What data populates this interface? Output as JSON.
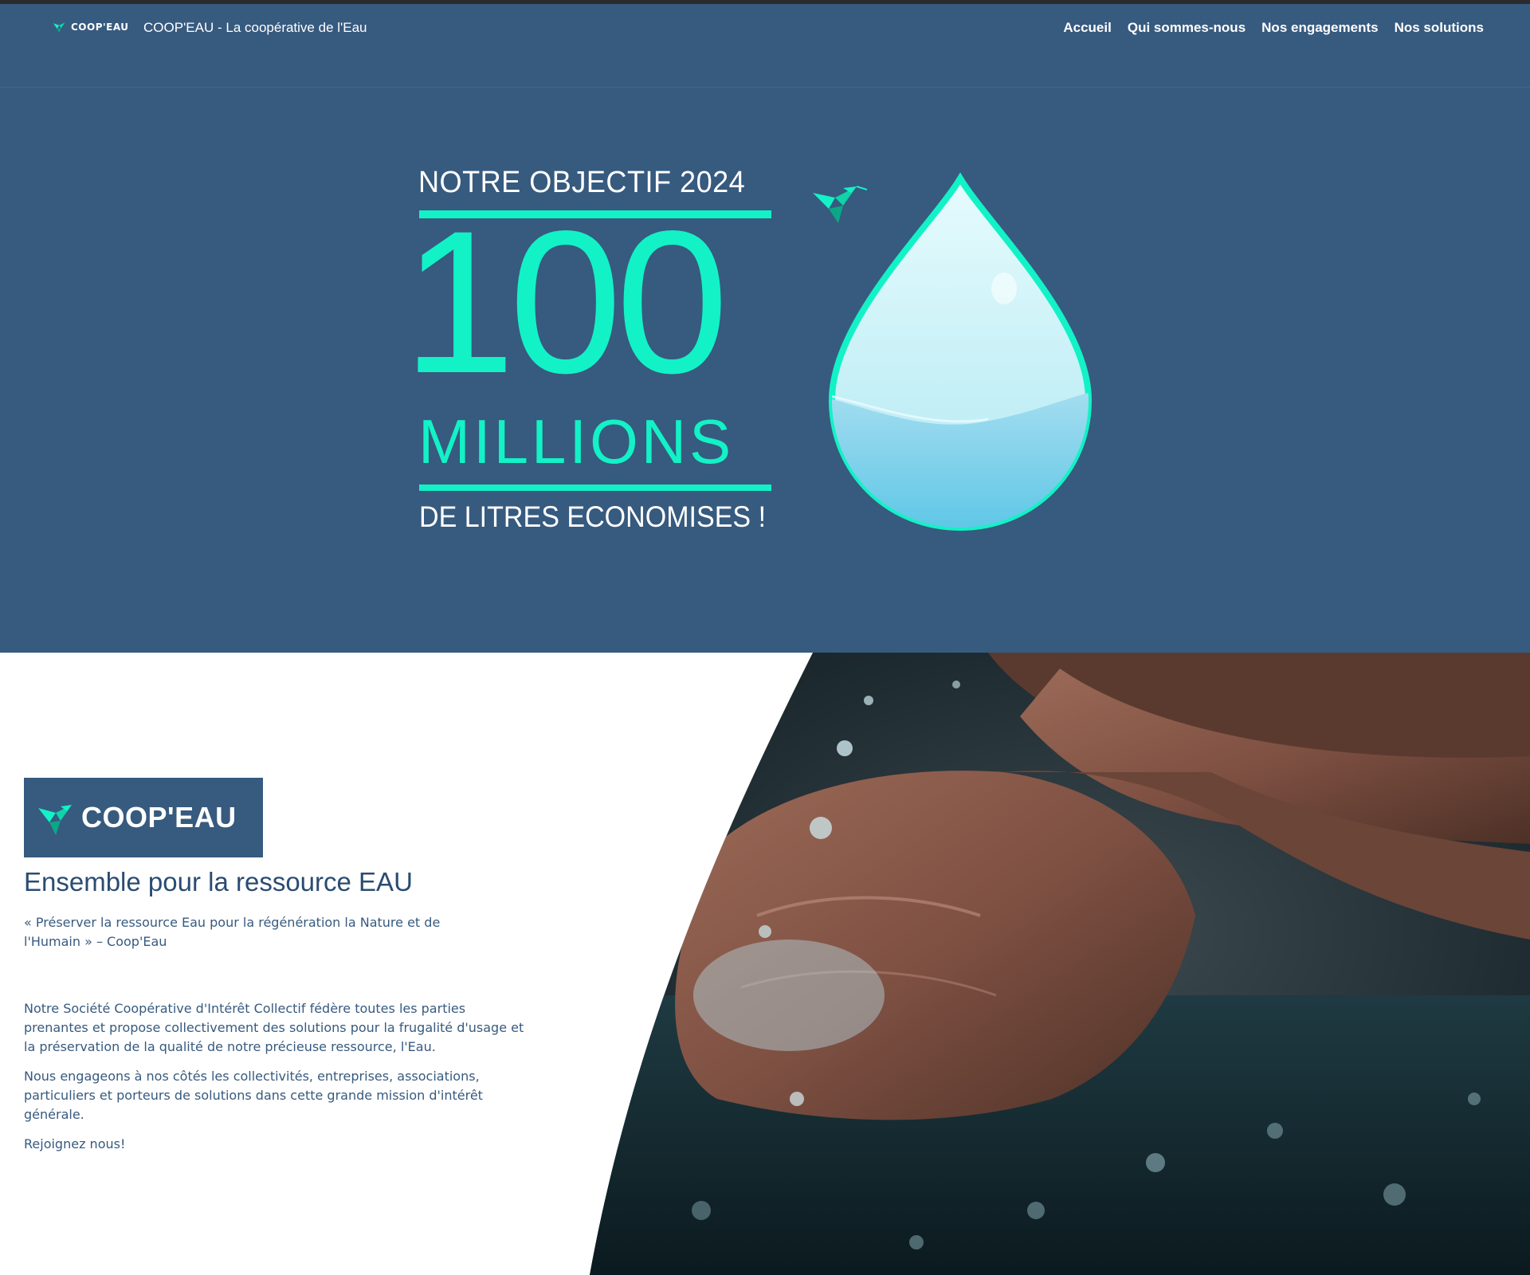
{
  "header": {
    "logo_text": "COOP'EAU",
    "site_title": "COOP'EAU - La coopérative de l'Eau",
    "nav": [
      "Accueil",
      "Qui sommes-nous",
      "Nos engagements",
      "Nos solutions"
    ]
  },
  "hero": {
    "line1": "NOTRE OBJECTIF 2024",
    "number": "100",
    "unit": "MILLIONS",
    "line2": "DE LITRES ECONOMISES !",
    "icon": "water-drop-icon",
    "accent_color": "#12f2c6",
    "background_color": "#375a7f"
  },
  "about": {
    "logo_text": "COOP'EAU",
    "tagline": "Ensemble pour la ressource EAU",
    "quote": "« Préserver la ressource Eau pour la régénération la Nature et de l'Humain » – Coop'Eau",
    "paragraphs": [
      "Notre Société Coopérative d'Intérêt Collectif fédère toutes les parties prenantes et propose collectivement des solutions pour la frugalité d'usage et la préservation de la qualité de notre précieuse ressource, l'Eau.",
      "Nous engageons à nos côtés les collectivités, entreprises, associations, particuliers et porteurs de solutions dans cette grande mission d'intérêt générale.",
      "Rejoignez nous!"
    ]
  }
}
